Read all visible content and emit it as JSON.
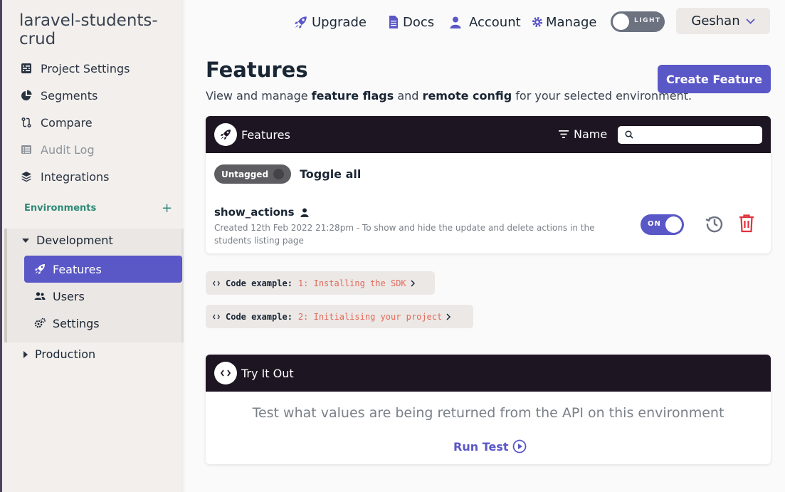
{
  "sidebar": {
    "project_name": "laravel-students-crud",
    "nav": [
      {
        "label": "Project Settings",
        "icon": "sliders-icon"
      },
      {
        "label": "Segments",
        "icon": "pie-chart-icon"
      },
      {
        "label": "Compare",
        "icon": "git-compare-icon"
      },
      {
        "label": "Audit Log",
        "icon": "list-icon"
      },
      {
        "label": "Integrations",
        "icon": "layers-icon"
      }
    ],
    "environments_label": "Environments",
    "environments_add": "+",
    "env_development": "Development",
    "dev_items": [
      {
        "label": "Features",
        "icon": "rocket-icon"
      },
      {
        "label": "Users",
        "icon": "users-icon"
      },
      {
        "label": "Settings",
        "icon": "gears-icon"
      }
    ],
    "env_production": "Production"
  },
  "topbar": {
    "upgrade": "Upgrade",
    "docs": "Docs",
    "account": "Account",
    "manage": "Manage",
    "theme_label": "LIGHT",
    "user": "Geshan"
  },
  "page": {
    "title": "Features",
    "desc_prefix": "View and manage ",
    "desc_bold1": "feature flags",
    "desc_mid": " and ",
    "desc_bold2": "remote config",
    "desc_suffix": " for your selected environment.",
    "create_button": "Create Feature"
  },
  "features_panel": {
    "title": "Features",
    "sort_label": "Name",
    "search_placeholder": "",
    "tag_label": "Untagged",
    "toggle_all": "Toggle all",
    "feature": {
      "name": "show_actions",
      "description": "Created 12th Feb 2022 21:28pm - To show and hide the update and delete actions in the students listing page",
      "toggle_label": "ON"
    }
  },
  "code_examples": [
    {
      "prefix": "Code example:",
      "label": "1: Installing the SDK"
    },
    {
      "prefix": "Code example:",
      "label": "2: Initialising your project"
    }
  ],
  "try_panel": {
    "title": "Try It Out",
    "text": "Test what values are being returned from the API on this environment",
    "run_test": "Run Test"
  },
  "colors": {
    "accent": "#5a57c7",
    "panel_header": "#1e1522",
    "env_green": "#2e8a76",
    "danger": "#e0313c",
    "code_red": "#e26a5a"
  }
}
